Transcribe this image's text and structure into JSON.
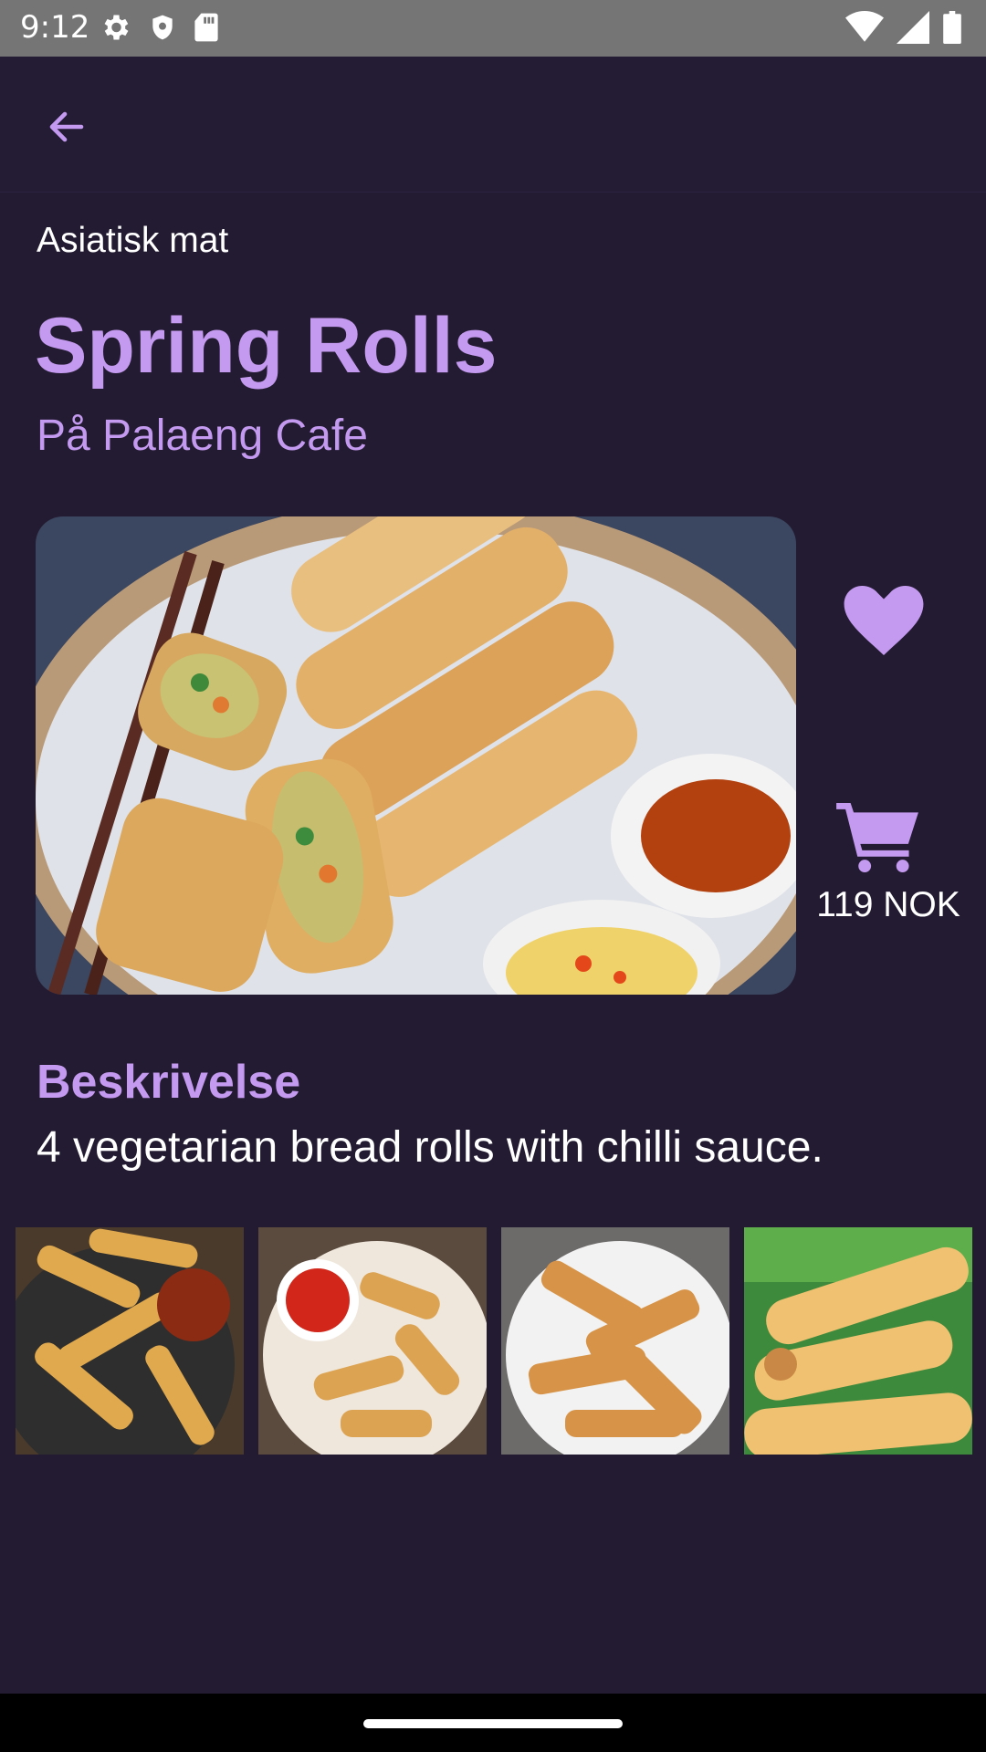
{
  "status_bar": {
    "time": "9:12",
    "left_icons": [
      "gear-icon",
      "shield-icon",
      "sd-card-icon"
    ],
    "right_icons": [
      "wifi-icon",
      "signal-icon",
      "battery-icon"
    ]
  },
  "app_bar": {
    "back_icon": "arrow-left-icon"
  },
  "dish": {
    "category": "Asiatisk mat",
    "title": "Spring Rolls",
    "restaurant": "På Palaeng Cafe",
    "price": "119 NOK",
    "description_heading": "Beskrivelse",
    "description": "4 vegetarian bread rolls with chilli sauce."
  },
  "actions": {
    "favorite_icon": "heart-icon",
    "cart_icon": "cart-icon"
  },
  "colors": {
    "background": "#231b31",
    "accent": "#c49af0",
    "status_bar": "#757575"
  },
  "gallery": {
    "count": 4
  }
}
